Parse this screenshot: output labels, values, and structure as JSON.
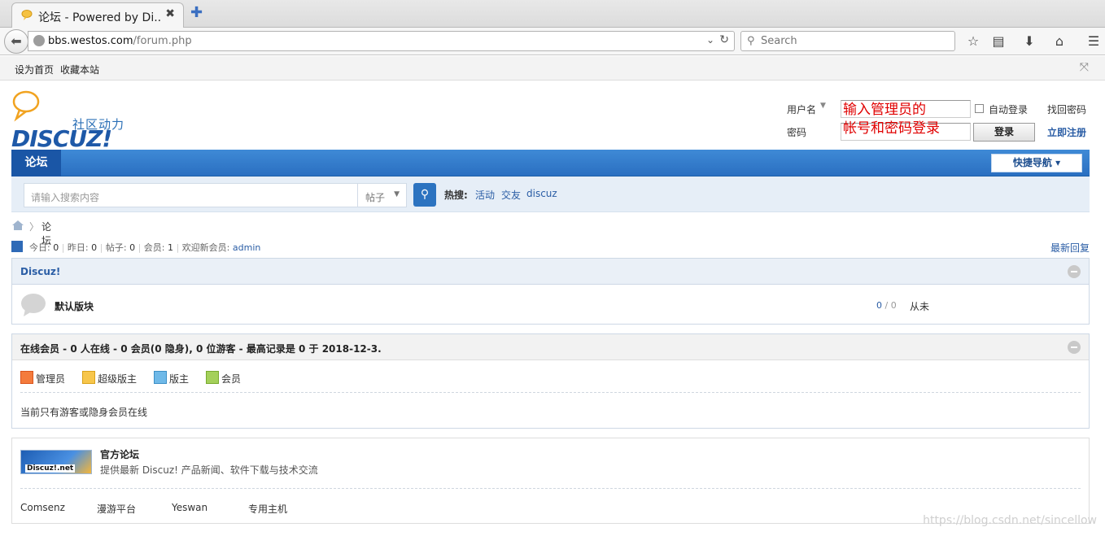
{
  "browser": {
    "tab_title": "论坛 - Powered by Di...",
    "tab_close": "✖",
    "new_tab": "✚",
    "url_host": "bbs.westos.com",
    "url_path": "/forum.php",
    "search_placeholder": "Search",
    "bookmarks": [
      "设为首页",
      "收藏本站"
    ]
  },
  "header": {
    "slogan": "社区动力",
    "logo_text": "DISCUZ!",
    "login": {
      "username_label": "用户名",
      "password_label": "密码",
      "overlay_line1": "输入管理员的",
      "overlay_line2": "帐号和密码登录",
      "auto_login": "自动登录",
      "login_button": "登录",
      "find_password": "找回密码",
      "register": "立即注册"
    }
  },
  "nav": {
    "forum": "论坛",
    "quick_nav": "快捷导航 ▾"
  },
  "search": {
    "placeholder": "请输入搜索内容",
    "type": "帖子",
    "hot_label": "热搜:",
    "hot": [
      "活动",
      "交友",
      "discuz"
    ]
  },
  "breadcrumb": {
    "current": "论坛"
  },
  "stats": {
    "today_label": "今日:",
    "today": "0",
    "yesterday_label": "昨日:",
    "yesterday": "0",
    "posts_label": "帖子:",
    "posts": "0",
    "members_label": "会员:",
    "members": "1",
    "newest_label": "欢迎新会员:",
    "newest": "admin",
    "latest_replies": "最新回复"
  },
  "category": {
    "title": "Discuz!",
    "forum_name": "默认版块",
    "threads": "0",
    "posts": "0",
    "last_post": "从未"
  },
  "online": {
    "title": "在线会员 - 0 人在线 - 0 会员(0 隐身), 0 位游客 - 最高记录是 0 于 2018-12-3.",
    "legend": [
      "管理员",
      "超级版主",
      "版主",
      "会员"
    ],
    "empty_text": "当前只有游客或隐身会员在线"
  },
  "links": {
    "logo_caption": "Discuz!.net",
    "title": "官方论坛",
    "desc": "提供最新 Discuz! 产品新闻、软件下载与技术交流",
    "partners": [
      "Comsenz",
      "漫游平台",
      "Yeswan",
      "专用主机"
    ]
  },
  "watermark": "https://blog.csdn.net/sincellow"
}
